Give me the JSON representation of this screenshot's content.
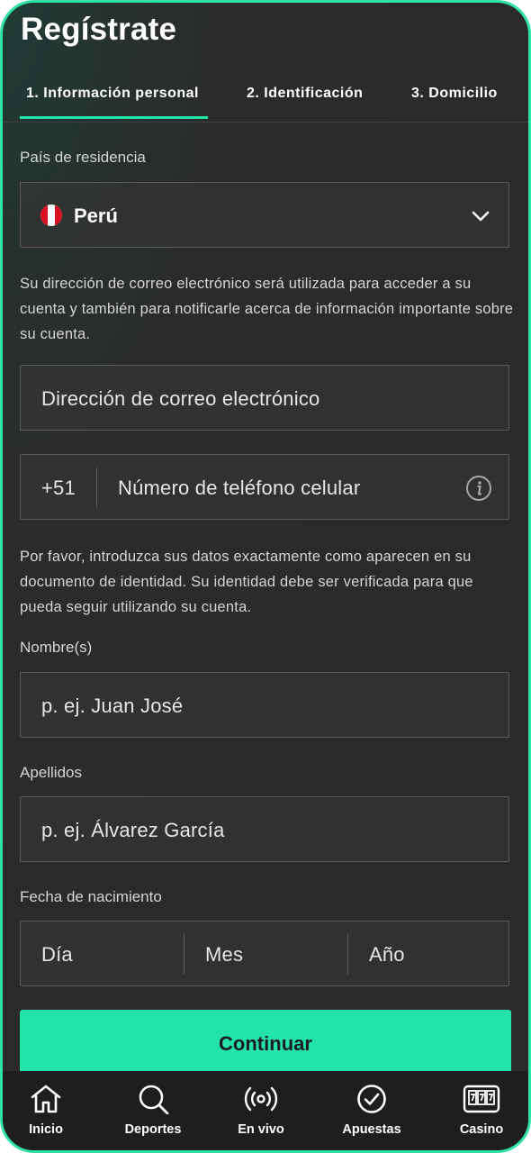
{
  "page": {
    "title": "Regístrate"
  },
  "tabs": [
    {
      "label": "1.  Información personal"
    },
    {
      "label": "2.  Identificación"
    },
    {
      "label": "3.  Domicilio"
    }
  ],
  "country": {
    "label": "País de residencia",
    "value": "Perú"
  },
  "email_info": "Su dirección de correo electrónico será utilizada para acceder a su cuenta y también para notificarle acerca de información importante sobre su cuenta.",
  "email": {
    "placeholder": "Dirección de correo electrónico"
  },
  "phone": {
    "prefix": "+51",
    "placeholder": "Número de teléfono celular"
  },
  "identity_info": "Por favor, introduzca sus datos exactamente como aparecen en su documento de identidad. Su identidad debe ser verificada para que pueda seguir utilizando su cuenta.",
  "first_name": {
    "label": "Nombre(s)",
    "placeholder": "p. ej. Juan José"
  },
  "last_name": {
    "label": "Apellidos",
    "placeholder": "p. ej. Álvarez García"
  },
  "birth_date": {
    "label": "Fecha de nacimiento",
    "day": "Día",
    "month": "Mes",
    "year": "Año"
  },
  "continue_button": "Continuar",
  "bottom_nav": [
    {
      "label": "Inicio",
      "icon": "home-icon"
    },
    {
      "label": "Deportes",
      "icon": "search-icon"
    },
    {
      "label": "En vivo",
      "icon": "live-broadcast-icon"
    },
    {
      "label": "Apuestas",
      "icon": "check-circle-icon"
    },
    {
      "label": "Casino",
      "icon": "slot-machine-icon"
    }
  ],
  "colors": {
    "accent": "#24e3a9",
    "frame": "#2fe3a6",
    "background": "#2a2a2a"
  }
}
